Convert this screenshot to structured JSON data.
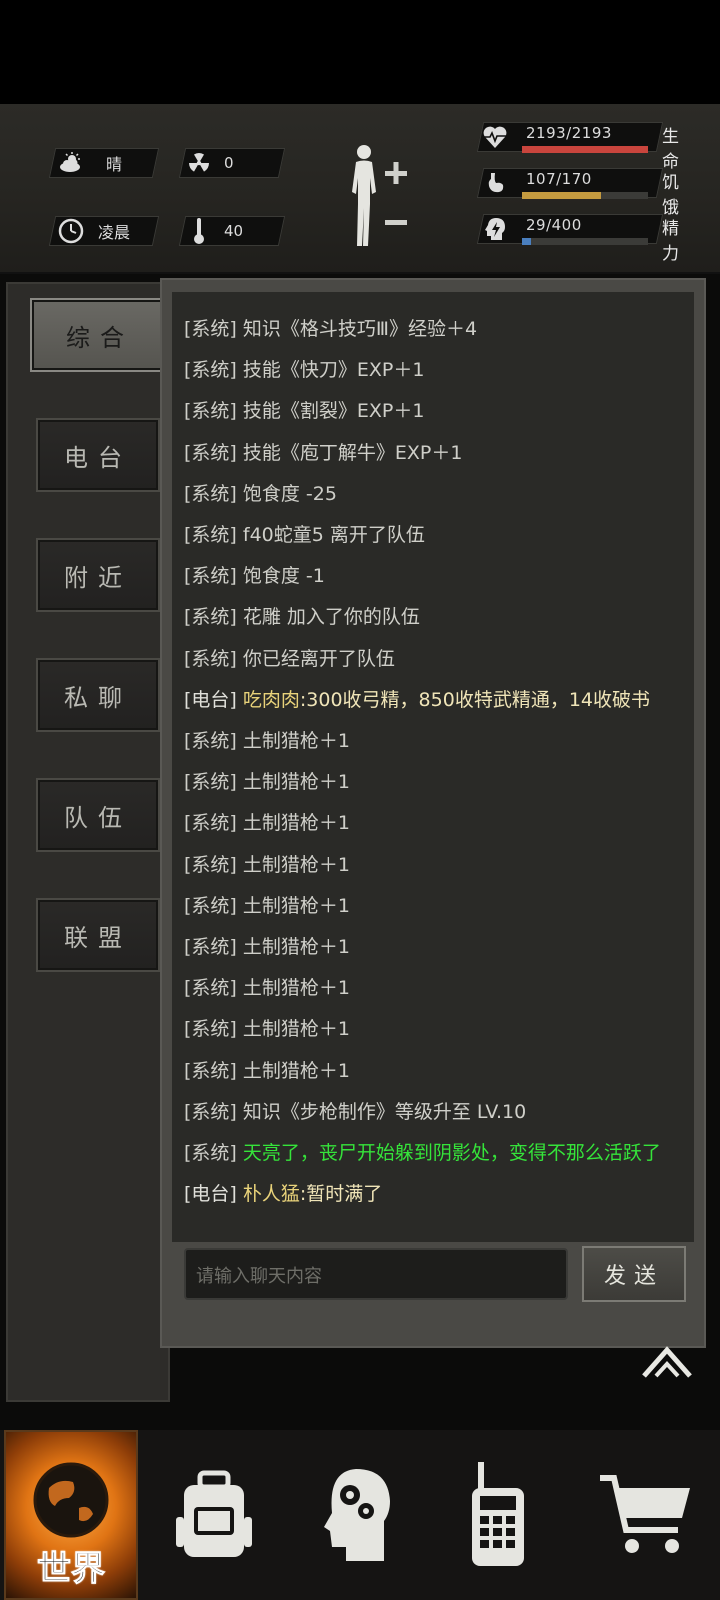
{
  "header": {
    "weather": {
      "icon": "partly-cloudy-icon",
      "label": "晴"
    },
    "radiation": {
      "icon": "radiation-icon",
      "value": "0"
    },
    "time_of_day": {
      "icon": "clock-icon",
      "label": "凌晨"
    },
    "temperature": {
      "icon": "thermometer-icon",
      "value": "40"
    },
    "stats": [
      {
        "name": "生命",
        "value": "2193/2193",
        "fraction": 1.0,
        "color": "#c9453d",
        "icon": "heart-pulse-icon"
      },
      {
        "name": "饥饿",
        "value": "107/170",
        "fraction": 0.63,
        "color": "#c49a3f",
        "icon": "stomach-icon"
      },
      {
        "name": "精力",
        "value": "29/400",
        "fraction": 0.0725,
        "color": "#4a7fbf",
        "icon": "energy-head-icon"
      }
    ]
  },
  "sidebar": {
    "tabs": [
      {
        "label": "综合",
        "active": true
      },
      {
        "label": "电台",
        "active": false
      },
      {
        "label": "附近",
        "active": false
      },
      {
        "label": "私聊",
        "active": false
      },
      {
        "label": "队伍",
        "active": false
      },
      {
        "label": "联盟",
        "active": false
      }
    ]
  },
  "chat": {
    "messages": [
      {
        "tag": "[系统]",
        "text": "知识《格斗技巧Ⅲ》经验＋4",
        "kind": "system"
      },
      {
        "tag": "[系统]",
        "text": "技能《快刀》EXP＋1",
        "kind": "system"
      },
      {
        "tag": "[系统]",
        "text": "技能《割裂》EXP＋1",
        "kind": "system"
      },
      {
        "tag": "[系统]",
        "text": "技能《庖丁解牛》EXP＋1",
        "kind": "system"
      },
      {
        "tag": "[系统]",
        "text": "饱食度 -25",
        "kind": "system"
      },
      {
        "tag": "[系统]",
        "text": "f40蛇童5 离开了队伍",
        "kind": "system"
      },
      {
        "tag": "[系统]",
        "text": "饱食度 -1",
        "kind": "system"
      },
      {
        "tag": "[系统]",
        "text": "花雕 加入了你的队伍",
        "kind": "system"
      },
      {
        "tag": "[系统]",
        "text": "你已经离开了队伍",
        "kind": "system"
      },
      {
        "tag": "[电台]",
        "name": "吃肉肉",
        "text": ":300收弓精，850收特武精通，14收破书",
        "kind": "radio"
      },
      {
        "tag": "[系统]",
        "text": "土制猎枪＋1",
        "kind": "system"
      },
      {
        "tag": "[系统]",
        "text": "土制猎枪＋1",
        "kind": "system"
      },
      {
        "tag": "[系统]",
        "text": "土制猎枪＋1",
        "kind": "system"
      },
      {
        "tag": "[系统]",
        "text": "土制猎枪＋1",
        "kind": "system"
      },
      {
        "tag": "[系统]",
        "text": "土制猎枪＋1",
        "kind": "system"
      },
      {
        "tag": "[系统]",
        "text": "土制猎枪＋1",
        "kind": "system"
      },
      {
        "tag": "[系统]",
        "text": "土制猎枪＋1",
        "kind": "system"
      },
      {
        "tag": "[系统]",
        "text": "土制猎枪＋1",
        "kind": "system"
      },
      {
        "tag": "[系统]",
        "text": "土制猎枪＋1",
        "kind": "system"
      },
      {
        "tag": "[系统]",
        "text": "知识《步枪制作》等级升至 LV.10",
        "kind": "system"
      },
      {
        "tag": "[系统]",
        "text": "天亮了，丧尸开始躲到阴影处，变得不那么活跃了",
        "kind": "green"
      },
      {
        "tag": "[电台]",
        "name": "朴人猛",
        "text": ":暂时满了",
        "kind": "radio"
      }
    ],
    "input_placeholder": "请输入聊天内容",
    "send_label": "发送"
  },
  "nav": {
    "world_label": "世界",
    "items": [
      {
        "name": "backpack-icon"
      },
      {
        "name": "skills-head-icon"
      },
      {
        "name": "walkie-talkie-icon"
      },
      {
        "name": "shopping-cart-icon"
      }
    ]
  }
}
